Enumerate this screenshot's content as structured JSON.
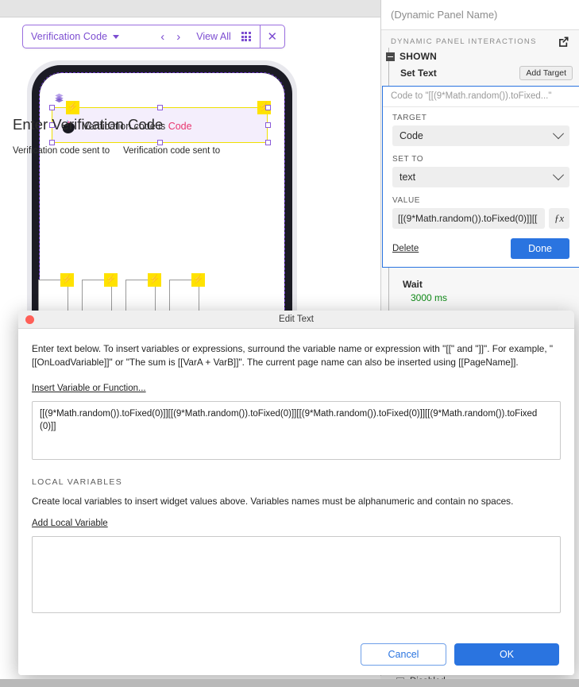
{
  "canvas": {
    "toolbar": {
      "page_name": "Verification Code",
      "caret_icon": "caret-down-icon",
      "prev_icon": "chevron-left-icon",
      "next_icon": "chevron-right-icon",
      "view_all_label": "View All",
      "grid_icon": "grid-icon",
      "close_icon": "close-icon",
      "accent_color": "#7c4dd1"
    },
    "screen": {
      "title": "Enter Verification Code",
      "subtitle_left": "Verification code sent to",
      "subtitle_right": "Verification code sent to",
      "selected_widget": {
        "text": "Verification code is ",
        "variable": "Code",
        "variable_color": "#e8366f",
        "fill": "#f4eefc",
        "border": "#efe000",
        "layers_icon": "layers-icon",
        "logo_icon": "axure-logo-icon",
        "bolt_icon": "lightning-bolt-icon"
      },
      "code_boxes": [
        {
          "bolt_icon": "lightning-bolt-icon"
        },
        {
          "bolt_icon": "lightning-bolt-icon"
        },
        {
          "bolt_icon": "lightning-bolt-icon"
        },
        {
          "bolt_icon": "lightning-bolt-icon"
        }
      ]
    }
  },
  "panel": {
    "panel_name_placeholder": "(Dynamic Panel Name)",
    "section_title": "DYNAMIC PANEL INTERACTIONS",
    "external_icon": "external-link-icon",
    "event": {
      "name": "SHOWN",
      "collapse_icon": "collapse-minus-icon"
    },
    "action": {
      "name": "Set Text",
      "add_target_label": "Add Target"
    },
    "editor": {
      "summary": "Code to \"[[(9*Math.random()).toFixed...\"",
      "target_label": "TARGET",
      "target_value": "Code",
      "set_to_label": "SET TO",
      "set_to_value": "text",
      "value_label": "VALUE",
      "value_text": "[[(9*Math.random()).toFixed(0)]][[",
      "fx_label": "ƒx",
      "delete_label": "Delete",
      "done_label": "Done",
      "border_color": "#2a74e0"
    },
    "wait": {
      "name": "Wait",
      "value": "3000 ms",
      "value_color": "#108a18"
    },
    "disabled_checkbox_label": "Disabled"
  },
  "modal": {
    "title": "Edit Text",
    "close_icon": "close-window-icon",
    "instructions": "Enter text below. To insert variables or expressions, surround the variable name or expression with \"[[\" and \"]]\". For example, \"[[OnLoadVariable]]\" or \"The sum is [[VarA + VarB]]\". The current page name can also be inserted using [[PageName]].",
    "insert_link_label": "Insert Variable or Function...",
    "textarea_value": "[[(9*Math.random()).toFixed(0)]][[(9*Math.random()).toFixed(0)]][[(9*Math.random()).toFixed(0)]][[(9*Math.random()).toFixed(0)]]",
    "local_variables_heading": "LOCAL VARIABLES",
    "local_variables_desc": "Create local variables to insert widget values above. Variables names must be alphanumeric and contain no spaces.",
    "add_local_variable_label": "Add Local Variable",
    "cancel_label": "Cancel",
    "ok_label": "OK",
    "primary_color": "#2a74e0"
  }
}
